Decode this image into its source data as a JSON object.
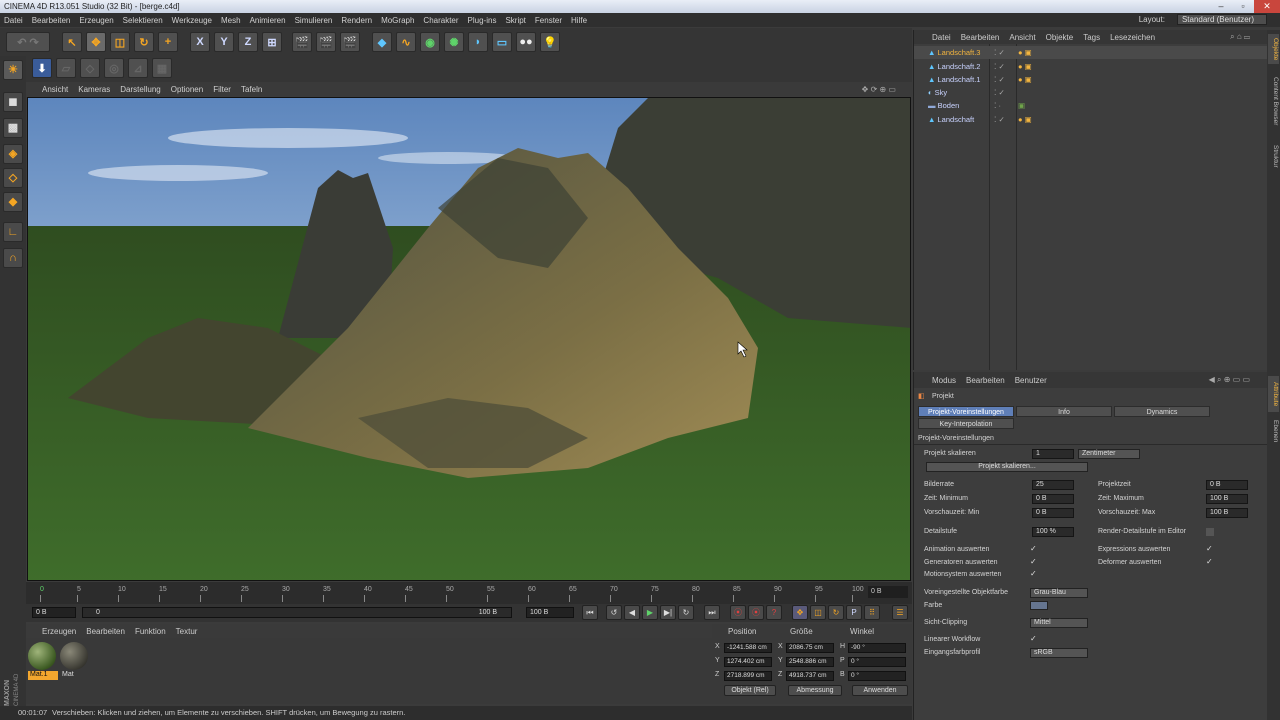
{
  "titlebar": {
    "title": "CINEMA 4D R13.051 Studio (32 Bit) - [berge.c4d]"
  },
  "menubar": {
    "items": [
      "Datei",
      "Bearbeiten",
      "Erzeugen",
      "Selektieren",
      "Werkzeuge",
      "Mesh",
      "Animieren",
      "Simulieren",
      "Rendern",
      "MoGraph",
      "Charakter",
      "Plug-ins",
      "Skript",
      "Fenster",
      "Hilfe"
    ],
    "layout_label": "Layout:",
    "layout_value": "Standard (Benutzer)"
  },
  "viewport": {
    "menu": [
      "Ansicht",
      "Kameras",
      "Darstellung",
      "Optionen",
      "Filter",
      "Tafeln"
    ]
  },
  "timeline": {
    "ticks": [
      "0",
      "5",
      "10",
      "15",
      "20",
      "25",
      "30",
      "35",
      "40",
      "45",
      "50",
      "55",
      "60",
      "65",
      "70",
      "75",
      "80",
      "85",
      "90",
      "95",
      "100"
    ],
    "current_frame": "0 B"
  },
  "transport": {
    "start": "0 B",
    "range_start": "0",
    "range_end": "100 B",
    "end": "100 B"
  },
  "material_manager": {
    "menu": [
      "Erzeugen",
      "Bearbeiten",
      "Funktion",
      "Textur"
    ],
    "materials": [
      {
        "name": "Mat.1",
        "selected": true
      },
      {
        "name": "Mat",
        "selected": false
      }
    ]
  },
  "coordinates": {
    "headers": {
      "position": "Position",
      "size": "Größe",
      "angle": "Winkel"
    },
    "rows": [
      {
        "axis": "X",
        "pos": "-1241.588 cm",
        "size_axis": "X",
        "size": "2086.75 cm",
        "rot_axis": "H",
        "rot": "-90 °"
      },
      {
        "axis": "Y",
        "pos": "1274.402 cm",
        "size_axis": "Y",
        "size": "2548.886 cm",
        "rot_axis": "P",
        "rot": "0 °"
      },
      {
        "axis": "Z",
        "pos": "2718.899 cm",
        "size_axis": "Z",
        "size": "4918.737 cm",
        "rot_axis": "B",
        "rot": "0 °"
      }
    ],
    "mode": "Objekt (Rel)",
    "size_mode": "Abmessung",
    "apply": "Anwenden"
  },
  "statusbar": {
    "time": "00:01:07",
    "message": "Verschieben: Klicken und ziehen, um Elemente zu verschieben. SHIFT drücken, um Bewegung zu rastern."
  },
  "object_manager": {
    "menu": [
      "Datei",
      "Bearbeiten",
      "Ansicht",
      "Objekte",
      "Tags",
      "Lesezeichen"
    ],
    "objects": [
      {
        "name": "Landschaft.3",
        "selected": true
      },
      {
        "name": "Landschaft.2",
        "selected": false
      },
      {
        "name": "Landschaft.1",
        "selected": false
      },
      {
        "name": "Sky",
        "selected": false
      },
      {
        "name": "Boden",
        "selected": false
      },
      {
        "name": "Landschaft",
        "selected": false
      }
    ]
  },
  "attribute_manager": {
    "menu": [
      "Modus",
      "Bearbeiten",
      "Benutzer"
    ],
    "object_title": "Projekt",
    "tabs": [
      "Projekt-Voreinstellungen",
      "Info",
      "Dynamics",
      "Key-Interpolation"
    ],
    "section": "Projekt-Voreinstellungen",
    "scale_label": "Projekt skalieren",
    "scale_value": "1",
    "scale_unit": "Zentimeter",
    "scale_button": "Projekt skalieren...",
    "fields": {
      "fps_label": "Bilderrate",
      "fps": "25",
      "projtime_label": "Projektzeit",
      "projtime": "0 B",
      "min_label": "Zeit: Minimum",
      "min": "0 B",
      "max_label": "Zeit: Maximum",
      "max": "100 B",
      "prevmin_label": "Vorschauzeit: Min",
      "prevmin": "0 B",
      "prevmax_label": "Vorschauzeit: Max",
      "prevmax": "100 B",
      "lod_label": "Detailstufe",
      "lod": "100 %",
      "renderlod_label": "Render-Detailstufe im Editor",
      "anim_label": "Animation auswerten",
      "expr_label": "Expressions auswerten",
      "gen_label": "Generatoren auswerten",
      "def_label": "Deformer auswerten",
      "motion_label": "Motionsystem auswerten",
      "objcolor_label": "Voreingestellte Objektfarbe",
      "objcolor": "Grau-Blau",
      "color_label": "Farbe",
      "clip_label": "Sicht-Clipping",
      "clip": "Mittel",
      "linear_label": "Linearer Workflow",
      "profile_label": "Eingangsfarbprofil",
      "profile": "sRGB"
    }
  },
  "side_tabs": {
    "top": [
      "Objekte",
      "Content Browser",
      "Struktur"
    ],
    "bottom": [
      "Attribute",
      "Ebenen"
    ]
  },
  "colors": {
    "accent_orange": "#f3b53f",
    "selection_blue": "#5f7fb8",
    "ground_green": "#3e6a2a",
    "sky_blue": "#6f95c4"
  }
}
